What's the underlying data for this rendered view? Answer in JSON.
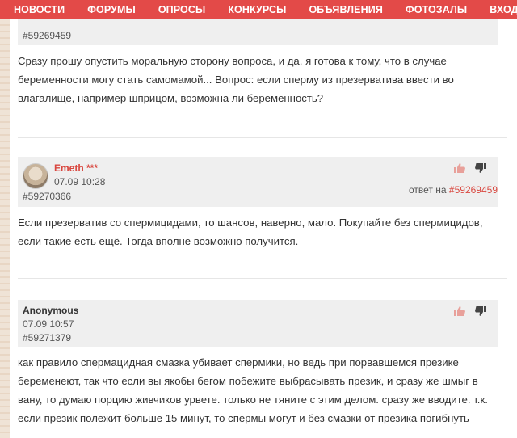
{
  "nav": {
    "items": [
      "НОВОСТИ",
      "ФОРУМЫ",
      "ОПРОСЫ",
      "КОНКУРСЫ",
      "ОБЪЯВЛЕНИЯ",
      "ФОТОЗАЛЫ",
      "ВХОД"
    ]
  },
  "posts": [
    {
      "id": "#59269459",
      "text": "Сразу прошу опустить моральную сторону вопроса, и да, я готова к тому, что в случае беременности могу стать самомамой... Вопрос: если сперму из презерватива ввести во влагалище, например шприцом, возможна ли беременность?"
    },
    {
      "author": "Emeth ***",
      "date": "07.09 10:28",
      "id": "#59270366",
      "reply_label": "ответ на",
      "reply_to": "#59269459",
      "text": "Если презерватив со спермицидами, то шансов, наверно, мало. Покупайте без спермицидов, если такие есть ещё. Тогда вполне возможно получится."
    },
    {
      "author": "Anonymous",
      "date": "07.09 10:57",
      "id": "#59271379",
      "text": "как правило спермацидная смазка убивает спермики, но ведь при порвавшемся презике беременеют, так что если вы якобы бегом побежите выбрасывать презик, и сразу же шмыг в вану, то думаю порцию живчиков урвете. только не тяните с этим делом. сразу же вводите. т.к. если презик полежит больше 15 минут, то спермы могут и без смазки от презика погибнуть"
    }
  ],
  "colors": {
    "nav_bg": "#e34a48",
    "accent": "#d9473f",
    "thumb": "#e8a09a"
  }
}
